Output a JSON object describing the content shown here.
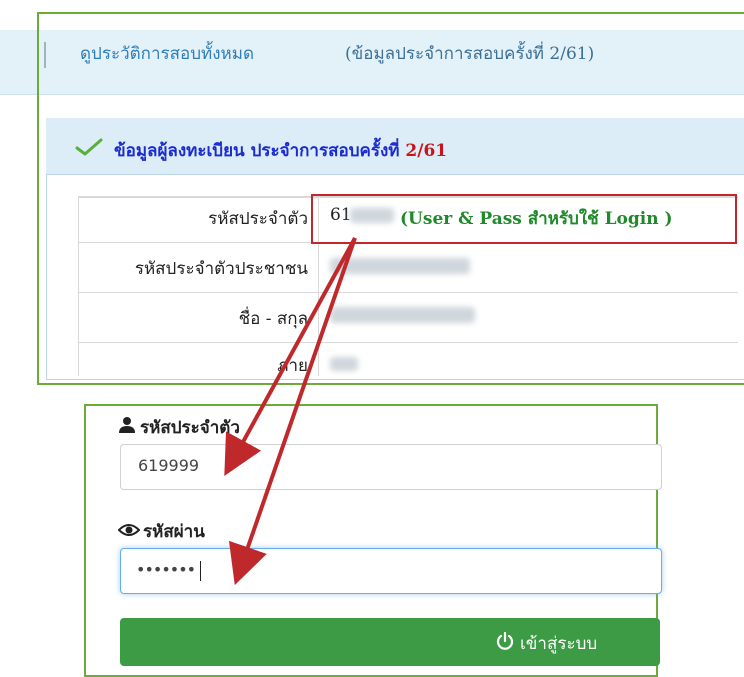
{
  "nav": {
    "history_link": "ดูประวัติการสอบทั้งหมด",
    "exam_info": "(ข้อมูลประจำการสอบครั้งที่ 2/61)"
  },
  "panel": {
    "title": "ข้อมูลผู้ลงทะเบียน ประจำการสอบครั้งที่",
    "title_number": "2/61",
    "rows": [
      {
        "label": "รหัสประจำตัว",
        "value_prefix": "61",
        "note": "(User & Pass สำหรับใช้ Login )"
      },
      {
        "label": "รหัสประจำตัวประชาชน"
      },
      {
        "label": "ชื่อ - สกุล"
      },
      {
        "label": "ภาย"
      }
    ]
  },
  "login": {
    "id_label": "รหัสประจำตัว",
    "id_value": "619999",
    "password_label": "รหัสผ่าน",
    "password_value": "•••••••",
    "button_label": "เข้าสู่ระบบ"
  },
  "colors": {
    "highlight_red": "#c0292b",
    "frame_green": "#6cab3a",
    "button_green": "#3d9b46",
    "title_blue": "#1a2bd0"
  },
  "icons": [
    "check-icon",
    "user-icon",
    "eye-icon",
    "power-icon",
    "arrow-icon"
  ]
}
